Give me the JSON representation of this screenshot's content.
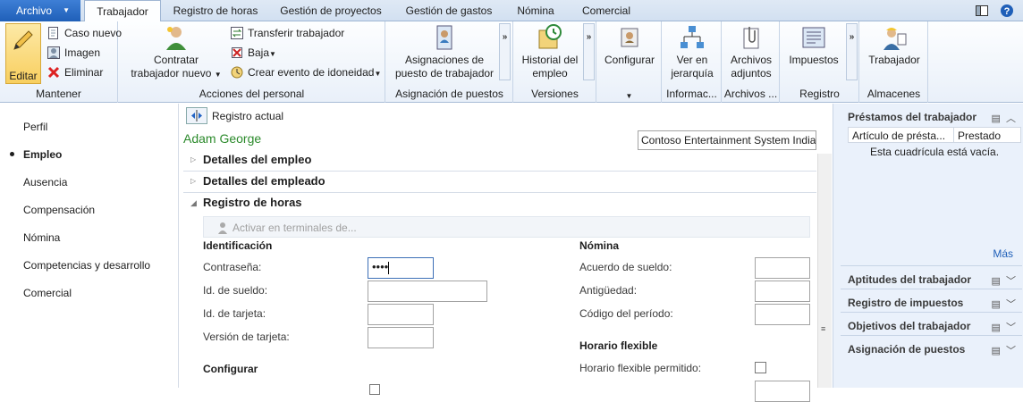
{
  "tabs": {
    "file": "Archivo",
    "items": [
      "Trabajador",
      "Registro de horas",
      "Gestión de proyectos",
      "Gestión de gastos",
      "Nómina",
      "Comercial"
    ]
  },
  "ribbon": {
    "mantener": {
      "label": "Mantener",
      "edit": "Editar",
      "new": "Caso nuevo",
      "image": "Imagen",
      "delete": "Eliminar"
    },
    "acciones": {
      "label": "Acciones del personal",
      "hire_1": "Contratar",
      "hire_2": "trabajador nuevo",
      "transfer": "Transferir trabajador",
      "terminate": "Baja",
      "event": "Crear evento de idoneidad"
    },
    "asignacion": {
      "label": "Asignación de puestos",
      "btn_1": "Asignaciones de",
      "btn_2": "puesto de trabajador"
    },
    "versiones": {
      "label": "Versiones",
      "btn_1": "Historial del",
      "btn_2": "empleo"
    },
    "configurar": {
      "btn": "Configurar"
    },
    "informacion": {
      "label": "Informac...",
      "btn_1": "Ver en",
      "btn_2": "jerarquía"
    },
    "archivos": {
      "label": "Archivos ...",
      "btn_1": "Archivos",
      "btn_2": "adjuntos"
    },
    "registro": {
      "label": "Registro",
      "btn": "Impuestos"
    },
    "almacenes": {
      "label": "Almacenes",
      "btn": "Trabajador"
    }
  },
  "nav": {
    "items": [
      "Perfil",
      "Empleo",
      "Ausencia",
      "Compensación",
      "Nómina",
      "Competencias y desarrollo",
      "Comercial"
    ]
  },
  "main": {
    "current_record": "Registro actual",
    "worker_name": "Adam George",
    "company": "Contoso Entertainment System India",
    "sections": [
      "Detalles del empleo",
      "Detalles del empleado",
      "Registro de horas"
    ],
    "activate": "Activar en terminales de...",
    "identificacion": {
      "title": "Identificación",
      "password": "Contraseña:",
      "password_value": "••••",
      "pay_id": "Id. de sueldo:",
      "card_id": "Id. de tarjeta:",
      "card_version": "Versión de tarjeta:"
    },
    "configurar_title": "Configurar",
    "nomina": {
      "title": "Nómina",
      "agreement": "Acuerdo de sueldo:",
      "seniority": "Antigüedad:",
      "period_code": "Código del período:"
    },
    "flex": {
      "title": "Horario flexible",
      "allowed": "Horario flexible permitido:"
    }
  },
  "factboxes": {
    "loans": {
      "title": "Préstamos del trabajador",
      "col1": "Artículo de présta...",
      "col2": "Prestado",
      "empty": "Esta cuadrícula está vacía.",
      "more": "Más"
    },
    "others": [
      "Aptitudes del trabajador",
      "Registro de impuestos",
      "Objetivos del trabajador",
      "Asignación de puestos"
    ]
  },
  "colors": {
    "accent": "#2163c4",
    "name_green": "#2b8a2b",
    "link": "#1f5fb8"
  }
}
